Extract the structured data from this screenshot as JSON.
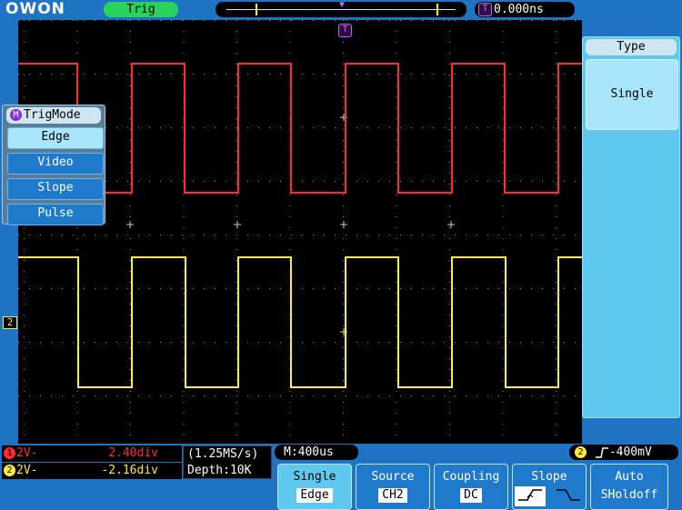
{
  "header": {
    "logo": "OWON",
    "trig_status": "Trig",
    "trig_marker": "T",
    "trig_time": "0.000ns"
  },
  "colors": {
    "ch1": "#ff2a2a",
    "ch2": "#ffee33",
    "screen_bg": "#000000",
    "ui_bg": "#1e73c3",
    "accent": "#5ec8ee"
  },
  "trigmode_menu": {
    "badge": "M",
    "title": "TrigMode",
    "items": [
      "Edge",
      "Video",
      "Slope",
      "Pulse"
    ],
    "selected": "Edge"
  },
  "right_panel": {
    "title": "Type",
    "item": "Single"
  },
  "channel_marker": "2",
  "status": {
    "ch1": {
      "badge": "1",
      "coupling": "2V-",
      "offset": "2.40div"
    },
    "ch2": {
      "badge": "2",
      "coupling": "2V-",
      "offset": "-2.16div"
    },
    "sample_rate": "(1.25MS/s)",
    "depth": "Depth:10K",
    "timebase": "M:400us",
    "trigger_channel": "2",
    "trigger_level": "-400mV"
  },
  "softkeys": [
    {
      "label": "Single",
      "value": "Edge"
    },
    {
      "label": "Source",
      "value": "CH2"
    },
    {
      "label": "Coupling",
      "value": "DC"
    },
    {
      "label": "Slope",
      "value": ""
    },
    {
      "label": "Auto",
      "value": "SHoldoff"
    }
  ]
}
